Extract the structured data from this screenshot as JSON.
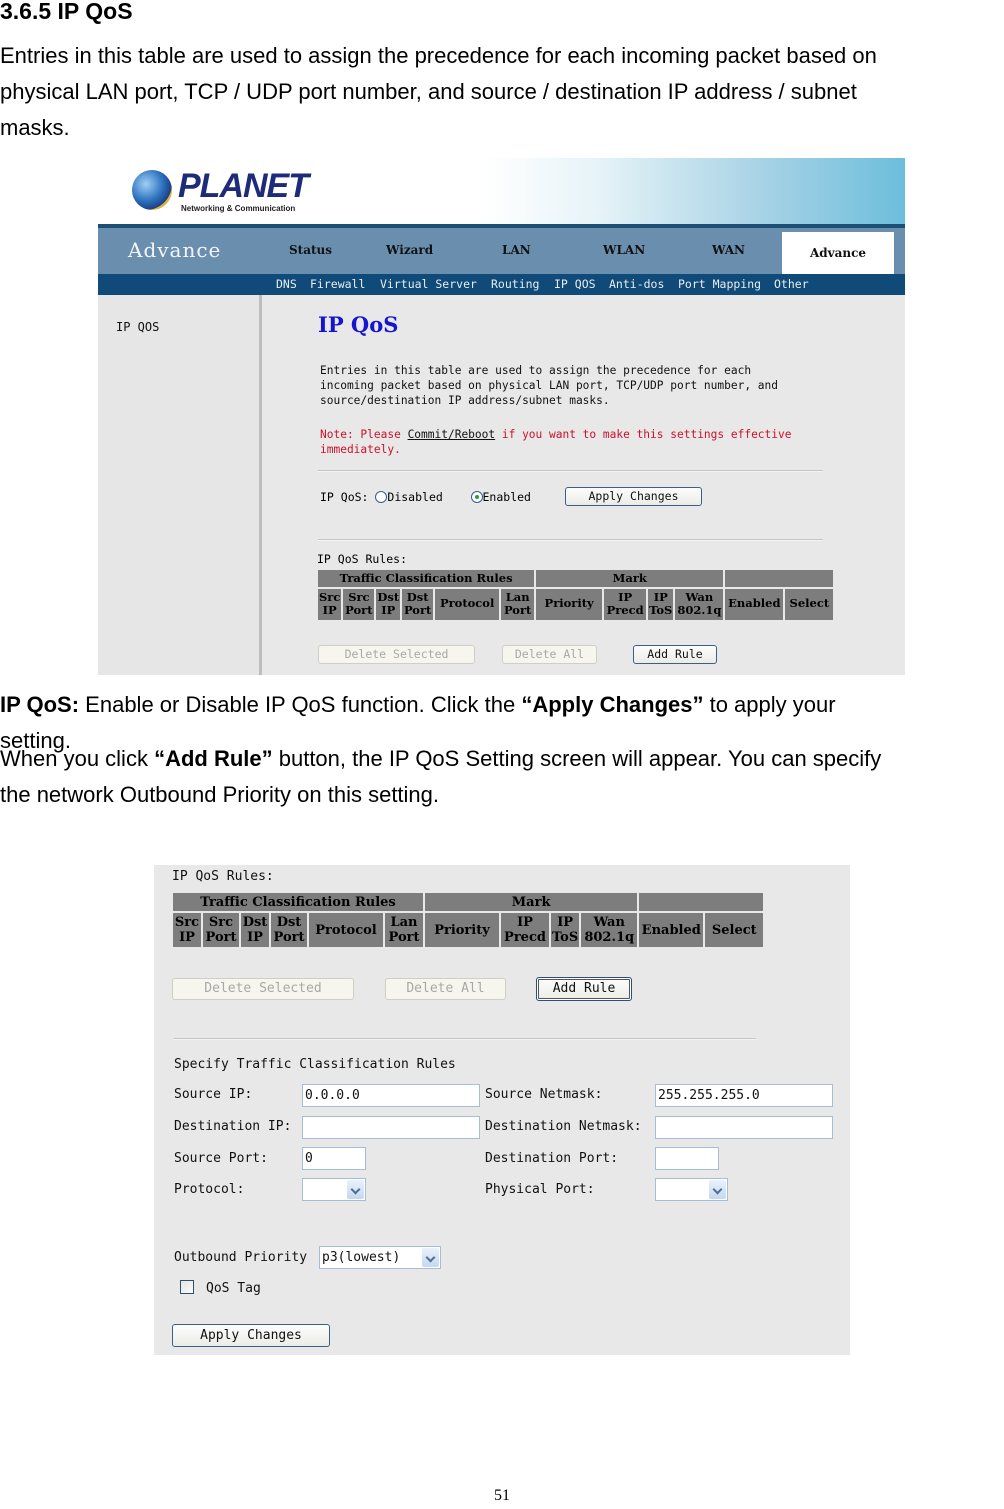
{
  "doc": {
    "heading": "3.6.5 IP QoS",
    "intro_lines": [
      "Entries in this table are used to assign the precedence for each incoming packet based on",
      "physical LAN port, TCP / UDP port number, and source / destination IP address / subnet",
      "masks."
    ],
    "para1": {
      "bold_lead": "IP QoS:",
      "text_a": " Enable or Disable IP QoS function. Click the ",
      "bold_mid": "“Apply Changes”",
      "text_b": " to apply your",
      "line2": "setting."
    },
    "para2": {
      "text_a": "When you click ",
      "bold_mid": "“Add Rule”",
      "text_b": " button, the IP QoS Setting screen will appear. You can specify",
      "line2": "the network Outbound Priority on this setting."
    },
    "page_number": "51"
  },
  "shot1": {
    "logo": {
      "word": "PLANET",
      "sub": "Networking & Communication"
    },
    "brand": "Advance",
    "nav": [
      "Status",
      "Wizard",
      "LAN",
      "WLAN",
      "WAN",
      "Advance"
    ],
    "nav_active": "Advance",
    "subnav": [
      "DNS",
      "Firewall",
      "Virtual Server",
      "Routing",
      "IP QOS",
      "Anti-dos",
      "Port Mapping",
      "Other"
    ],
    "sidebar": [
      "IP QOS"
    ],
    "title": "IP QoS",
    "desc": "Entries in this table are used to assign the precedence for each\nincoming packet based on physical LAN port, TCP/UDP port number, and\nsource/destination IP address/subnet masks.",
    "note_a": "Note: Please ",
    "note_link": "Commit/Reboot",
    "note_b": " if you want to make this settings effective",
    "note_c": "immediately.",
    "qos_label": "IP QoS:",
    "qos_options": [
      "Disabled",
      "Enabled"
    ],
    "qos_selected": "Enabled",
    "apply_label": "Apply Changes",
    "rules_label": "IP QoS Rules:"
  },
  "rules_table": {
    "groups": [
      "Traffic Classification Rules",
      "Mark",
      ""
    ],
    "columns": [
      [
        "Src",
        "IP"
      ],
      [
        "Src",
        "Port"
      ],
      [
        "Dst",
        "IP"
      ],
      [
        "Dst",
        "Port"
      ],
      [
        "Protocol"
      ],
      [
        "Lan",
        "Port"
      ],
      [
        "Priority"
      ],
      [
        "IP",
        "Precd"
      ],
      [
        "IP",
        "ToS"
      ],
      [
        "Wan",
        "802.1q"
      ],
      [
        "Enabled"
      ],
      [
        "Select"
      ]
    ],
    "rows": []
  },
  "buttons": {
    "delete_selected": "Delete Selected",
    "delete_all": "Delete All",
    "add_rule": "Add Rule",
    "apply_changes": "Apply Changes"
  },
  "shot2": {
    "rules_label": "IP QoS Rules:",
    "section_title": "Specify Traffic Classification Rules",
    "fields": {
      "source_ip": {
        "label": "Source IP:",
        "value": "0.0.0.0"
      },
      "source_netmask": {
        "label": "Source Netmask:",
        "value": "255.255.255.0"
      },
      "destination_ip": {
        "label": "Destination IP:",
        "value": ""
      },
      "destination_netmask": {
        "label": "Destination Netmask:",
        "value": ""
      },
      "source_port": {
        "label": "Source Port:",
        "value": "0"
      },
      "destination_port": {
        "label": "Destination Port:",
        "value": ""
      },
      "protocol": {
        "label": "Protocol:",
        "value": ""
      },
      "physical_port": {
        "label": "Physical Port:",
        "value": ""
      }
    },
    "outbound_priority": {
      "label": "Outbound Priority",
      "value": "p3(lowest)"
    },
    "qos_tag": {
      "label": "QoS Tag",
      "checked": false
    }
  }
}
